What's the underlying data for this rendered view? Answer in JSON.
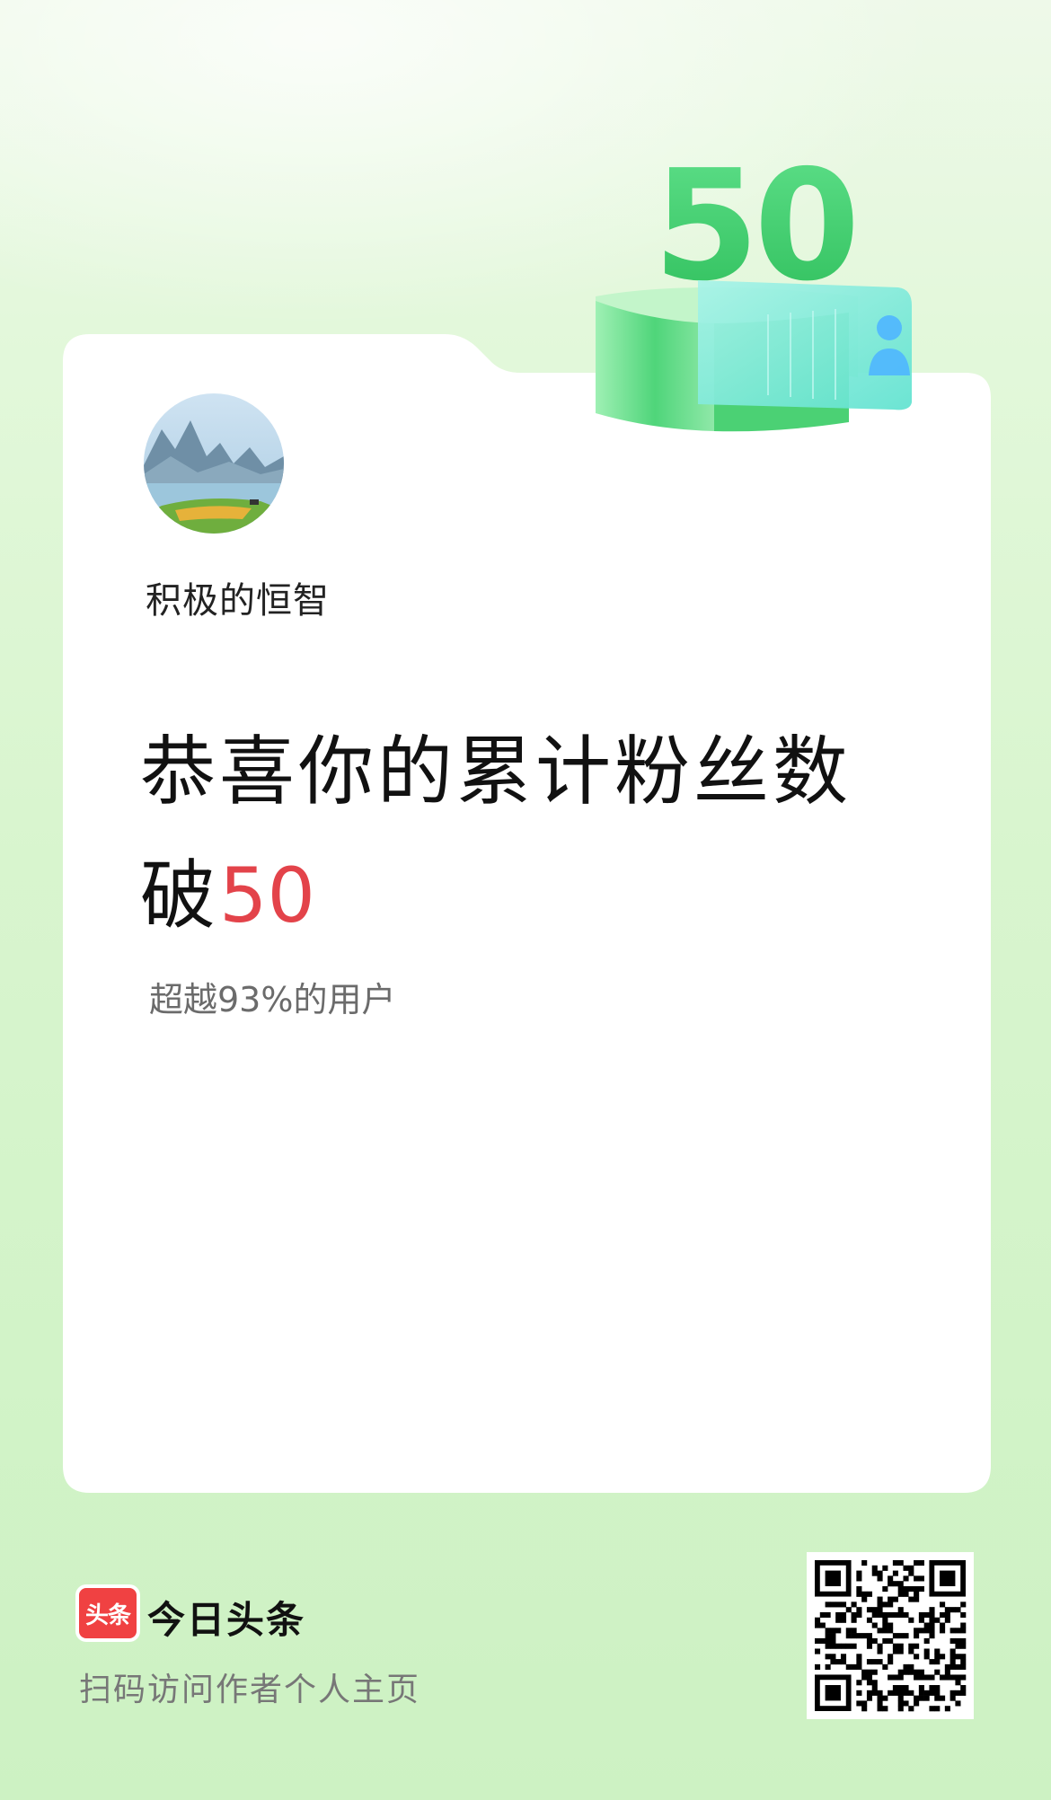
{
  "profile": {
    "username": "积极的恒智",
    "avatar_icon": "landscape-avatar"
  },
  "milestone": {
    "badge_number": "50",
    "headline_prefix": "恭喜你的累计粉丝数破",
    "headline_number": "50",
    "headline_number_color": "#e3434a",
    "subtext": "超越93%的用户"
  },
  "footer": {
    "logo_text": "头条",
    "brand_name": "今日头条",
    "tip": "扫码访问作者个人主页",
    "qr_icon": "qr-code-icon"
  },
  "colors": {
    "accent_green": "#3fce6c",
    "card_bg": "#ffffff",
    "logo_red": "#f04142"
  }
}
